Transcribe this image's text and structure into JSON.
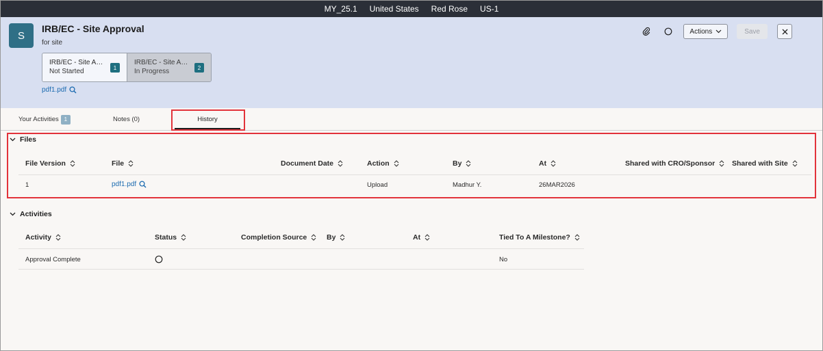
{
  "topbar": {
    "items": [
      "MY_25.1",
      "United States",
      "Red Rose",
      "US-1"
    ]
  },
  "header": {
    "avatar_letter": "S",
    "title": "IRB/EC - Site Approval",
    "subtitle": "for site",
    "actions_label": "Actions",
    "save_label": "Save",
    "steps": [
      {
        "title": "IRB/EC - Site Approval",
        "status": "Not Started",
        "num": "1"
      },
      {
        "title": "IRB/EC - Site Approval",
        "status": "In Progress",
        "num": "2"
      }
    ],
    "file_link": "pdf1.pdf"
  },
  "tabs": [
    {
      "label": "Your Activities",
      "badge": "1"
    },
    {
      "label": "Notes (0)"
    },
    {
      "label": "History"
    }
  ],
  "files": {
    "section_title": "Files",
    "columns": [
      "File Version",
      "File",
      "Document Date",
      "Action",
      "By",
      "At",
      "Shared with CRO/Sponsor",
      "Shared with Site"
    ],
    "rows": [
      {
        "version": "1",
        "file": "pdf1.pdf",
        "document_date": "",
        "action": "Upload",
        "by": "Madhur Y.",
        "at": "26MAR2026",
        "shared_cro": "",
        "shared_site": ""
      }
    ]
  },
  "activities": {
    "section_title": "Activities",
    "columns": [
      "Activity",
      "Status",
      "Completion Source",
      "By",
      "At",
      "Tied To A Milestone?"
    ],
    "rows": [
      {
        "activity": "Approval Complete",
        "status_icon": "circle-status-icon",
        "completion_source": "",
        "by": "",
        "at": "",
        "milestone": "No"
      }
    ]
  },
  "colors": {
    "topbar": "#2b2f38",
    "header": "#d8dff1",
    "accent": "#1e6f80",
    "link": "#1c6bb0",
    "highlight": "#e2323a"
  }
}
